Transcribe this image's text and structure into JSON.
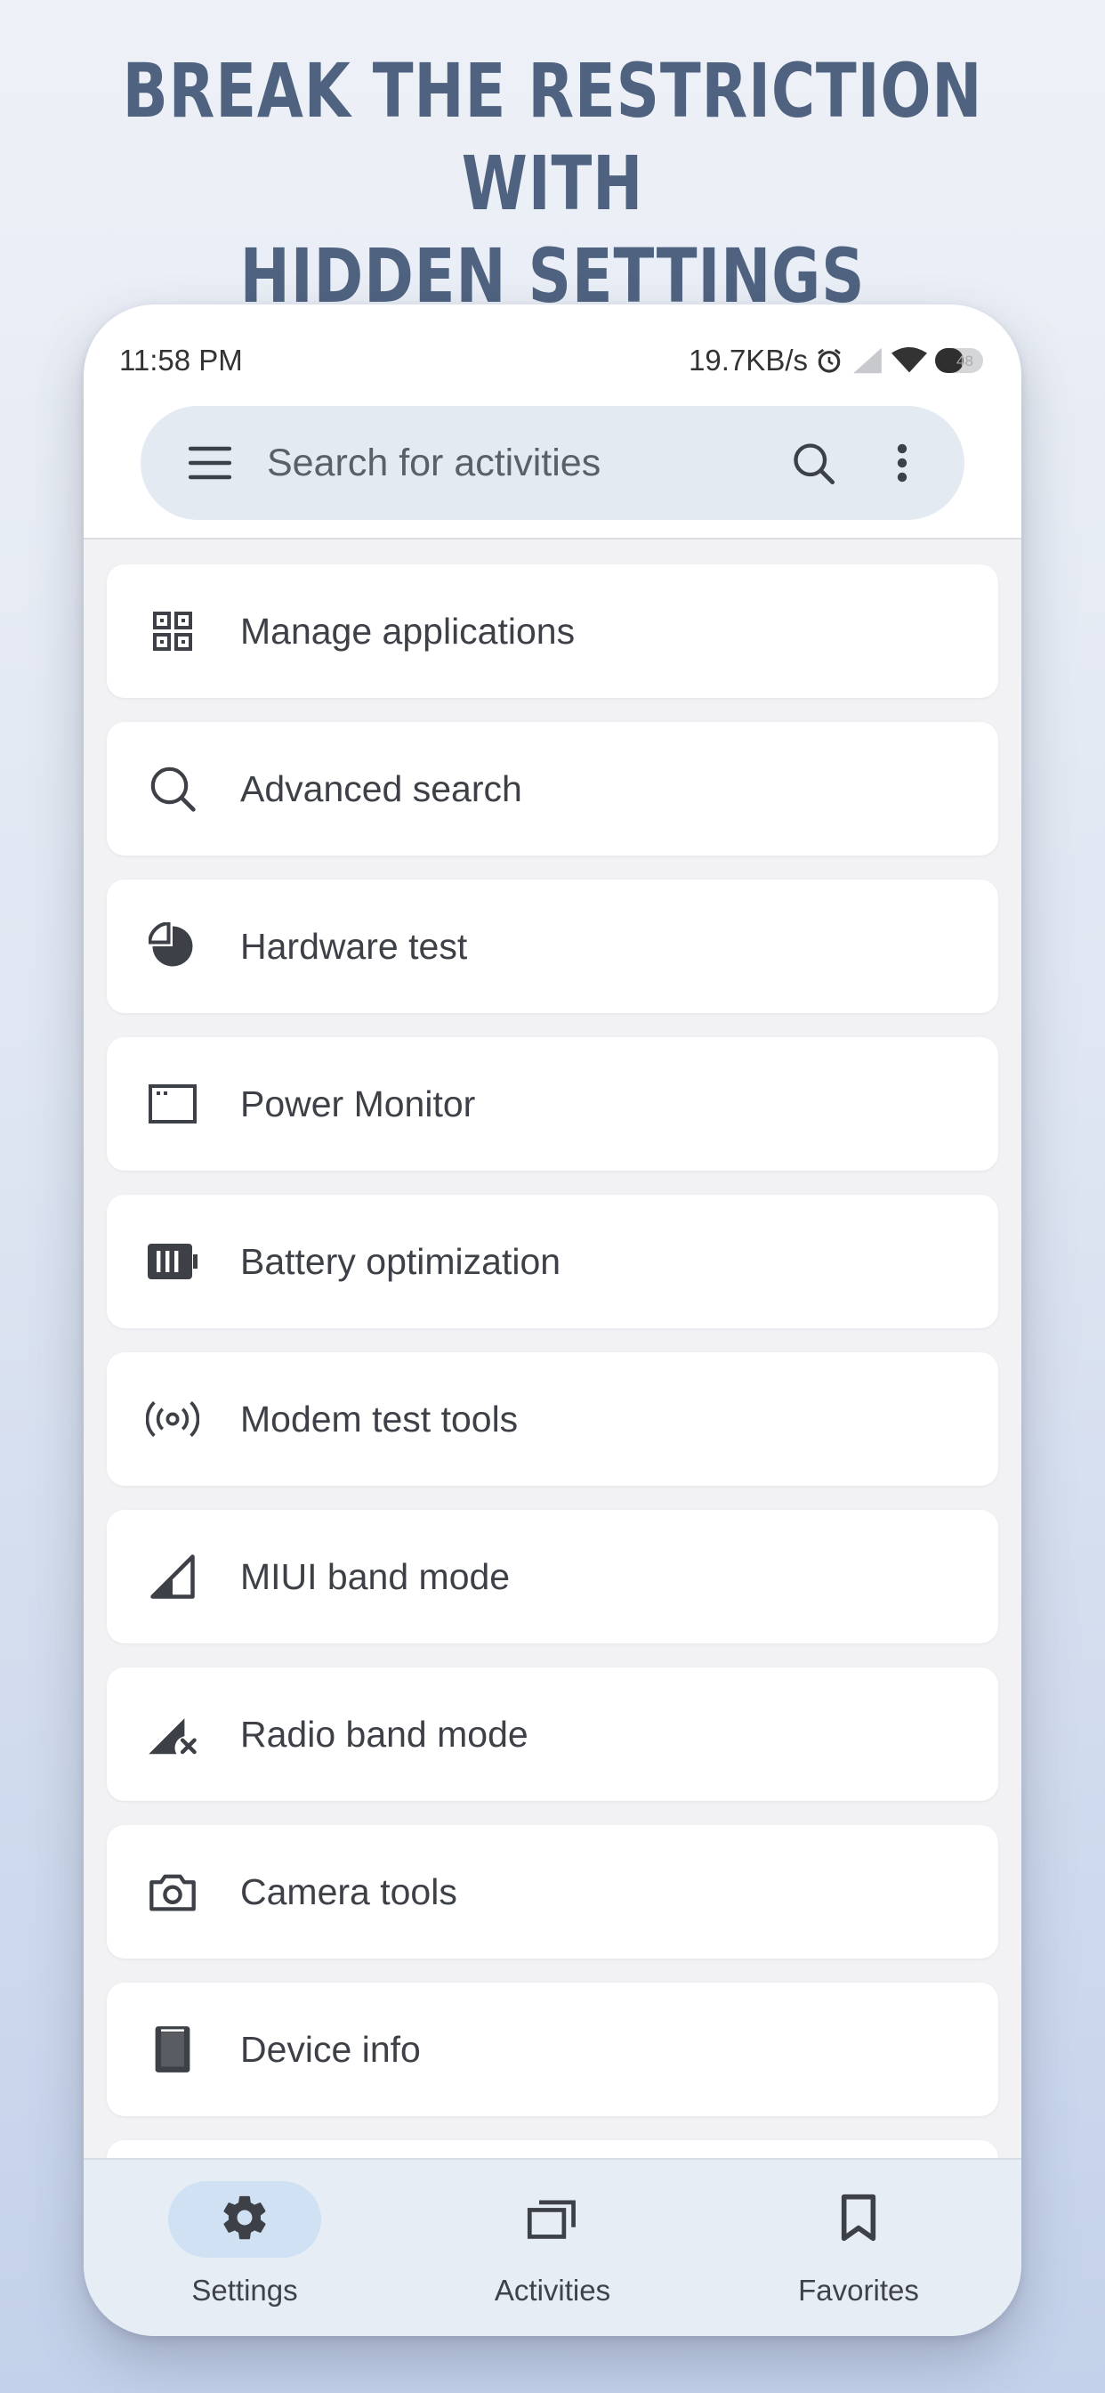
{
  "headline": {
    "line1": "BREAK THE RESTRICTION WITH",
    "line2": "HIDDEN SETTINGS"
  },
  "statusbar": {
    "time": "11:58 PM",
    "network_speed": "19.7KB/s",
    "battery_level": "48",
    "icons": [
      "alarm-icon",
      "signal-icon",
      "wifi-icon",
      "battery-icon"
    ]
  },
  "search": {
    "placeholder": "Search for activities",
    "icons": [
      "menu-icon",
      "search-icon",
      "more-vert-icon"
    ]
  },
  "list": {
    "items": [
      {
        "label": "Manage applications",
        "icon": "grid-apps-icon"
      },
      {
        "label": "Advanced search",
        "icon": "search-icon"
      },
      {
        "label": "Hardware test",
        "icon": "pie-chart-icon"
      },
      {
        "label": "Power Monitor",
        "icon": "window-icon"
      },
      {
        "label": "Battery optimization",
        "icon": "battery-icon"
      },
      {
        "label": "Modem test tools",
        "icon": "broadcast-icon"
      },
      {
        "label": "MIUI band mode",
        "icon": "signal-icon"
      },
      {
        "label": "Radio band mode",
        "icon": "signal-off-icon"
      },
      {
        "label": "Camera tools",
        "icon": "camera-icon"
      },
      {
        "label": "Device info",
        "icon": "device-icon"
      }
    ]
  },
  "bottom_nav": {
    "items": [
      {
        "label": "Settings",
        "icon": "gear-icon",
        "active": true
      },
      {
        "label": "Activities",
        "icon": "windows-icon",
        "active": false
      },
      {
        "label": "Favorites",
        "icon": "bookmark-icon",
        "active": false
      }
    ]
  },
  "colors": {
    "headline": "#4f6380",
    "search_bg": "#e3eaf2",
    "list_bg": "#f2f1f4",
    "nav_bg": "#e7edf5",
    "nav_active": "#cfe1f3",
    "icon": "#3d4147"
  }
}
